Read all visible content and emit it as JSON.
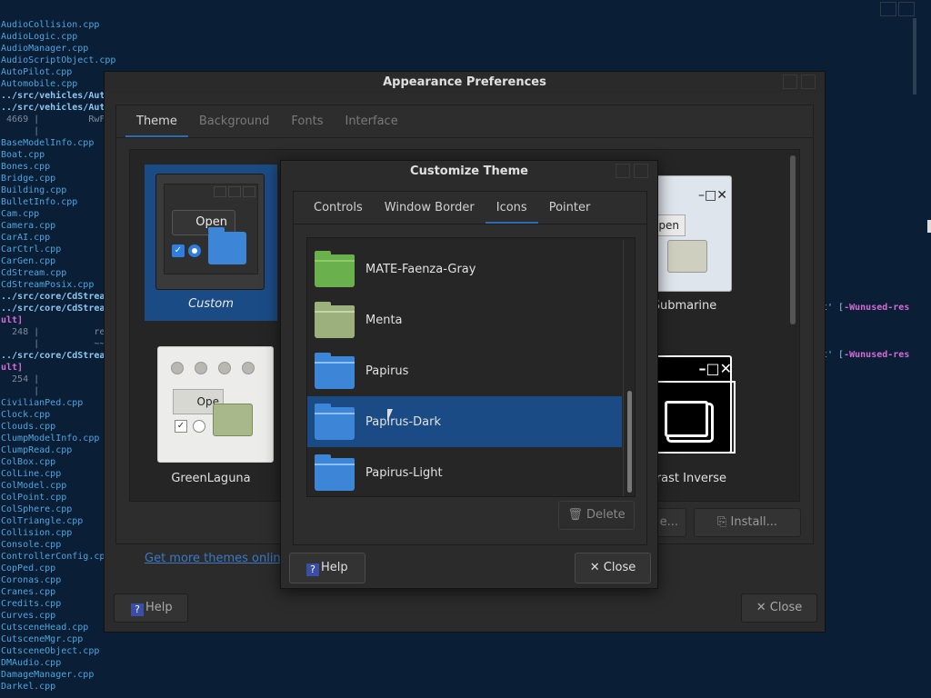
{
  "terminal": {
    "lines": [
      {
        "t": "AudioCollision.cpp",
        "c": ""
      },
      {
        "t": "AudioLogic.cpp",
        "c": ""
      },
      {
        "t": "AudioManager.cpp",
        "c": ""
      },
      {
        "t": "AudioScriptObject.cpp",
        "c": ""
      },
      {
        "t": "AutoPilot.cpp",
        "c": ""
      },
      {
        "t": "Automobile.cpp",
        "c": ""
      },
      {
        "t": "../src/vehicles/Aut",
        "c": "tl-bold"
      },
      {
        "t": "../src/vehicles/Aut",
        "c": "tl-bold"
      },
      {
        "t": " 4669 |         RwF",
        "c": "tl-gray"
      },
      {
        "t": "      |",
        "c": "tl-gray"
      },
      {
        "t": "BaseModelInfo.cpp",
        "c": ""
      },
      {
        "t": "Boat.cpp",
        "c": ""
      },
      {
        "t": "Bones.cpp",
        "c": ""
      },
      {
        "t": "Bridge.cpp",
        "c": ""
      },
      {
        "t": "Building.cpp",
        "c": ""
      },
      {
        "t": "BulletInfo.cpp",
        "c": ""
      },
      {
        "t": "Cam.cpp",
        "c": ""
      },
      {
        "t": "Camera.cpp",
        "c": ""
      },
      {
        "t": "CarAI.cpp",
        "c": ""
      },
      {
        "t": "CarCtrl.cpp",
        "c": ""
      },
      {
        "t": "CarGen.cpp",
        "c": ""
      },
      {
        "t": "CdStream.cpp",
        "c": ""
      },
      {
        "t": "CdStreamPosix.cpp",
        "c": ""
      },
      {
        "t": "../src/core/CdStrea",
        "c": "tl-bold"
      },
      {
        "t": "../src/core/CdStrea",
        "c": "tl-bold"
      },
      {
        "t": "ult]",
        "c": "tl-mag"
      },
      {
        "t": "  248 |          rea",
        "c": "tl-gray"
      },
      {
        "t": "      |          ~~~",
        "c": "tl-gray"
      },
      {
        "t": "../src/core/CdStrea",
        "c": "tl-bold"
      },
      {
        "t": "ult]",
        "c": "tl-mag"
      },
      {
        "t": "  254 |",
        "c": "tl-gray"
      },
      {
        "t": "      |",
        "c": "tl-gray"
      },
      {
        "t": "CivilianPed.cpp",
        "c": ""
      },
      {
        "t": "Clock.cpp",
        "c": ""
      },
      {
        "t": "Clouds.cpp",
        "c": ""
      },
      {
        "t": "ClumpModelInfo.cpp",
        "c": ""
      },
      {
        "t": "ClumpRead.cpp",
        "c": ""
      },
      {
        "t": "ColBox.cpp",
        "c": ""
      },
      {
        "t": "ColLine.cpp",
        "c": ""
      },
      {
        "t": "ColModel.cpp",
        "c": ""
      },
      {
        "t": "ColPoint.cpp",
        "c": ""
      },
      {
        "t": "ColSphere.cpp",
        "c": ""
      },
      {
        "t": "ColTriangle.cpp",
        "c": ""
      },
      {
        "t": "Collision.cpp",
        "c": ""
      },
      {
        "t": "Console.cpp",
        "c": ""
      },
      {
        "t": "ControllerConfig.cp",
        "c": ""
      },
      {
        "t": "CopPed.cpp",
        "c": ""
      },
      {
        "t": "Coronas.cpp",
        "c": ""
      },
      {
        "t": "Cranes.cpp",
        "c": ""
      },
      {
        "t": "Credits.cpp",
        "c": ""
      },
      {
        "t": "Curves.cpp",
        "c": ""
      },
      {
        "t": "CutsceneHead.cpp",
        "c": ""
      },
      {
        "t": "CutsceneMgr.cpp",
        "c": ""
      },
      {
        "t": "CutsceneObject.cpp",
        "c": ""
      },
      {
        "t": "DMAudio.cpp",
        "c": ""
      },
      {
        "t": "DamageManager.cpp",
        "c": ""
      },
      {
        "t": "Darkel.cpp",
        "c": ""
      }
    ],
    "right_warn_1": "t' [",
    "right_warn_1_flag": "-Wunused-res",
    "right_warn_2": "t' [",
    "right_warn_2_flag": "-Wunused-res"
  },
  "appearance": {
    "title": "Appearance Preferences",
    "tabs": [
      "Theme",
      "Background",
      "Fonts",
      "Interface"
    ],
    "themes": {
      "custom": {
        "label": "Custom",
        "open_label": "Open"
      },
      "green": {
        "label": "GreenLaguna",
        "open_label": "Ope"
      },
      "submarine": {
        "label": "Submarine",
        "open_label": "pen",
        "controls": "–□✕"
      },
      "contrast": {
        "label": "ntrast Inverse",
        "controls": "–□✕"
      }
    },
    "save_label": "e...",
    "install_label": "Install...",
    "get_more_label": "Get more themes online",
    "help_label": "Help",
    "close_label": "Close"
  },
  "customize": {
    "title": "Customize Theme",
    "tabs": [
      "Controls",
      "Window Border",
      "Icons",
      "Pointer"
    ],
    "icons": [
      {
        "label": "MATE-Faenza-Gray",
        "style": "f-green"
      },
      {
        "label": "Menta",
        "style": "f-menta"
      },
      {
        "label": "Papirus",
        "style": "f-blue"
      },
      {
        "label": "Papirus-Dark",
        "style": "f-blue"
      },
      {
        "label": "Papirus-Light",
        "style": "f-blue"
      }
    ],
    "selected_index": 3,
    "delete_label": "Delete",
    "help_label": "Help",
    "close_label": "Close"
  },
  "colors": {
    "accent": "#2e6bb0",
    "selection": "#1b4b85",
    "terminal_bg": "#0a1e36"
  },
  "icons": {
    "help": "help-icon",
    "close": "close-icon",
    "delete": "trash-icon",
    "install": "install-icon",
    "save": "save-icon"
  }
}
